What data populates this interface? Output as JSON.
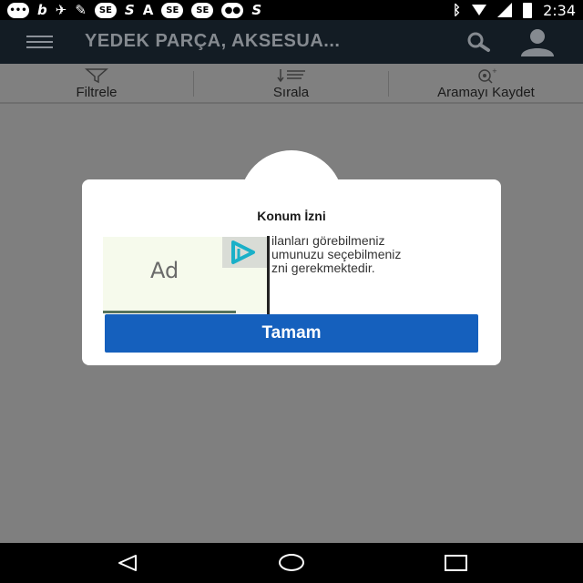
{
  "status_bar": {
    "time": "2:34",
    "left_icons": [
      "chat-icon",
      "b-icon",
      "bird-icon",
      "wrench-icon",
      "se-icon",
      "s-icon",
      "a-icon",
      "se-icon",
      "se-icon",
      "game-icon",
      "s-icon"
    ],
    "right_icons": [
      "bluetooth-icon",
      "wifi-icon",
      "signal-icon",
      "battery-icon"
    ]
  },
  "app_bar": {
    "title": "YEDEK PARÇA, AKSESUA..."
  },
  "actions": [
    {
      "label": "Filtrele"
    },
    {
      "label": "Sırala"
    },
    {
      "label": "Aramayı Kaydet"
    }
  ],
  "dialog": {
    "title": "Konum İzni",
    "body_lines": [
      "ilanları görebilmeniz",
      "umunuzu seçebilmeniz",
      "zni gerekmektedir."
    ],
    "ok_button": "Tamam"
  },
  "ad": {
    "label": "Ad"
  },
  "colors": {
    "app_bar": "#131c24",
    "button": "#1560bd",
    "overlay": "#7f7f7f"
  }
}
